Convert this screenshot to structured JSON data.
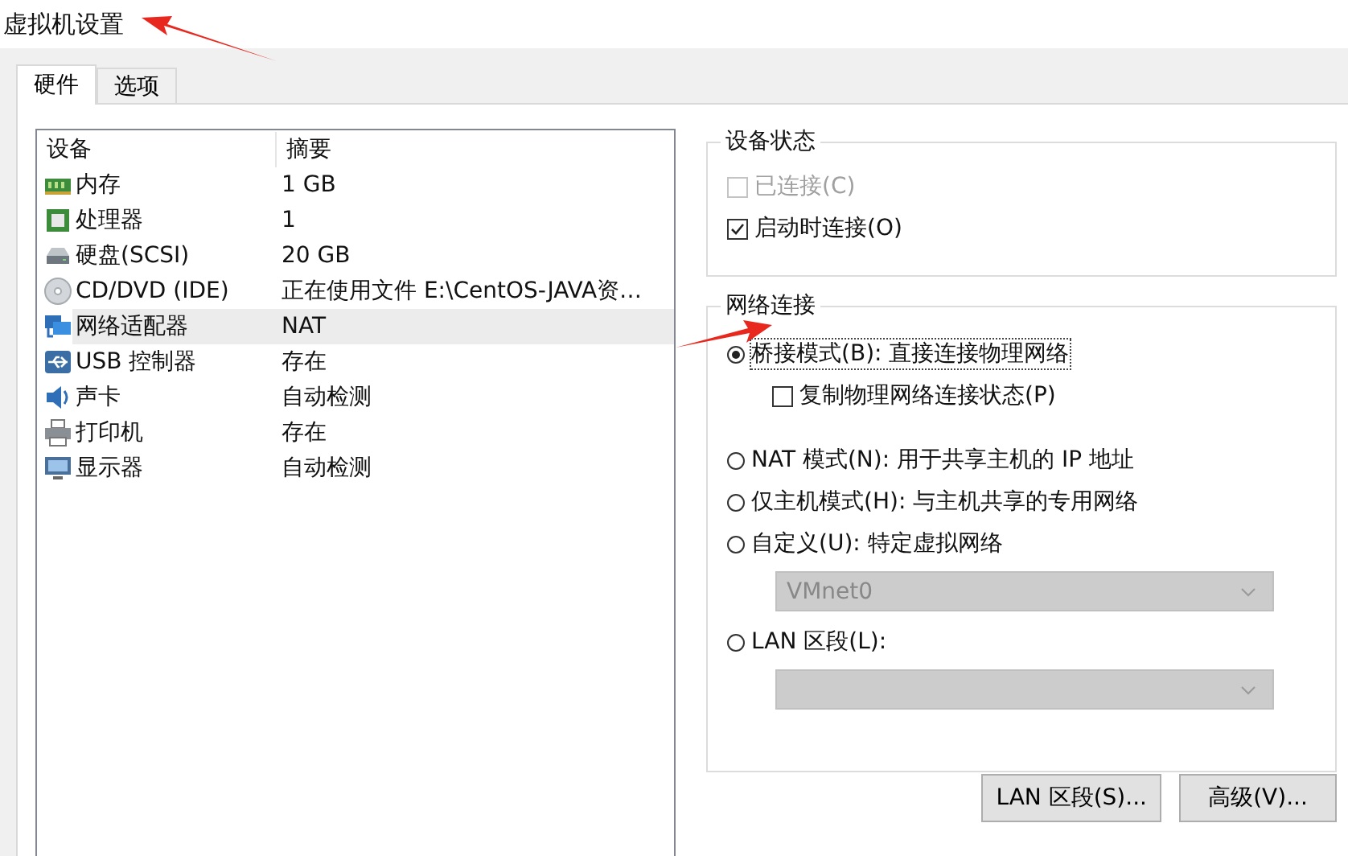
{
  "window": {
    "title": "虚拟机设置"
  },
  "tabs": [
    {
      "label": "硬件",
      "selected": true
    },
    {
      "label": "选项",
      "selected": false
    }
  ],
  "device_table": {
    "columns": [
      "设备",
      "摘要"
    ],
    "rows": [
      {
        "device": "内存",
        "summary": "1 GB",
        "selected": false
      },
      {
        "device": "处理器",
        "summary": "1",
        "selected": false
      },
      {
        "device": "硬盘(SCSI)",
        "summary": "20 GB",
        "selected": false
      },
      {
        "device": "CD/DVD (IDE)",
        "summary": "正在使用文件 E:\\CentOS-JAVA资…",
        "selected": false
      },
      {
        "device": "网络适配器",
        "summary": "NAT",
        "selected": true
      },
      {
        "device": "USB 控制器",
        "summary": "存在",
        "selected": false
      },
      {
        "device": "声卡",
        "summary": "自动检测",
        "selected": false
      },
      {
        "device": "打印机",
        "summary": "存在",
        "selected": false
      },
      {
        "device": "显示器",
        "summary": "自动检测",
        "selected": false
      }
    ]
  },
  "device_status": {
    "title": "设备状态",
    "items": [
      {
        "label": "已连接(C)",
        "checked": false,
        "disabled": true
      },
      {
        "label": "启动时连接(O)",
        "checked": true,
        "disabled": false
      }
    ]
  },
  "network_connection": {
    "title": "网络连接",
    "items": [
      {
        "kind": "radio",
        "label": "桥接模式(B): 直接连接物理网络",
        "selected": true
      },
      {
        "kind": "checkbox",
        "label": "复制物理网络连接状态(P)",
        "checked": false
      },
      {
        "kind": "radio",
        "label": "NAT 模式(N): 用于共享主机的 IP 地址",
        "selected": false
      },
      {
        "kind": "radio",
        "label": "仅主机模式(H): 与主机共享的专用网络",
        "selected": false
      },
      {
        "kind": "radio",
        "label": "自定义(U): 特定虚拟网络",
        "selected": false
      },
      {
        "kind": "select",
        "value": "VMnet0",
        "disabled": true
      },
      {
        "kind": "radio",
        "label": "LAN 区段(L):",
        "selected": false
      },
      {
        "kind": "select",
        "disabled": true
      }
    ]
  },
  "buttons": [
    "LAN 区段(S)...",
    "高级(V)..."
  ]
}
